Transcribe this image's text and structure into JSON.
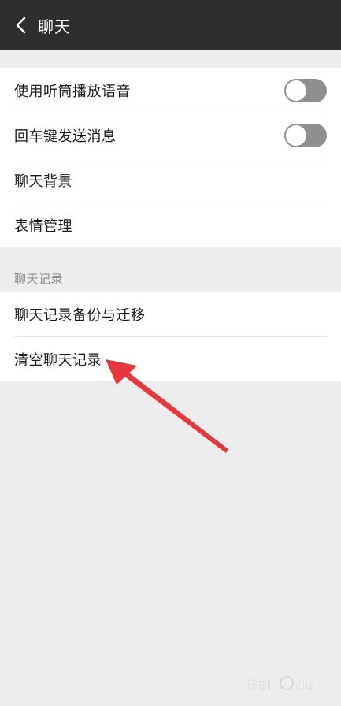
{
  "header": {
    "title": "聊天",
    "back_icon": "chevron-left-icon"
  },
  "settings": {
    "items": [
      {
        "label": "使用听筒播放语音",
        "toggle": "off"
      },
      {
        "label": "回车键发送消息",
        "toggle": "off"
      },
      {
        "label": "聊天背景"
      },
      {
        "label": "表情管理"
      }
    ]
  },
  "chat_records": {
    "section_label": "聊天记录",
    "items": [
      {
        "label": "聊天记录备份与迁移"
      },
      {
        "label": "清空聊天记录"
      }
    ]
  },
  "colors": {
    "header_bg": "#2e2e2e",
    "page_bg": "#ededed",
    "toggle_off": "#8f8f8f",
    "arrow": "#e8373c"
  },
  "annotation": {
    "arrow_icon": "red-arrow-icon",
    "watermark_icon": "baidu-watermark-icon"
  }
}
